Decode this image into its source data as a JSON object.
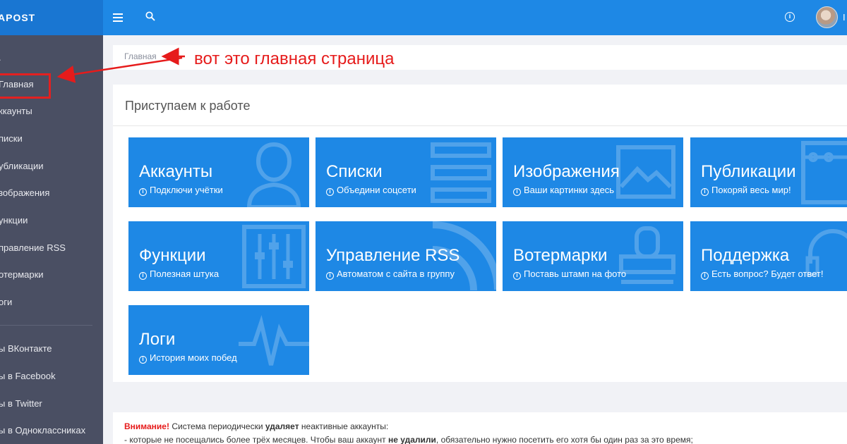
{
  "app": {
    "brand": "APOST",
    "user_initial": "I"
  },
  "topbar": {
    "menu_icon": "menu-icon",
    "search_icon": "search-icon",
    "info_icon": "info-icon"
  },
  "sidebar": {
    "items": [
      {
        "label": "Главная"
      },
      {
        "label": "ккаунты"
      },
      {
        "label": "писки"
      },
      {
        "label": "убликации"
      },
      {
        "label": "зображения"
      },
      {
        "label": "ункции"
      },
      {
        "label": "правление RSS"
      },
      {
        "label": "отермарки"
      },
      {
        "label": "оги"
      }
    ],
    "groups": [
      {
        "label": "ы ВКонтакте"
      },
      {
        "label": "ы в Facebook"
      },
      {
        "label": "ы в Twitter"
      },
      {
        "label": "ы в Одноклассниках"
      }
    ]
  },
  "breadcrumb": {
    "current": "Главная"
  },
  "annotation": {
    "text": "вот это главная страница",
    "color": "#e61b1b"
  },
  "panel": {
    "title": "Приступаем к работе"
  },
  "tiles": [
    {
      "title": "Аккаунты",
      "subtitle": "Подключи учётки",
      "icon": "user-icon"
    },
    {
      "title": "Списки",
      "subtitle": "Объедини соцсети",
      "icon": "list-icon"
    },
    {
      "title": "Изображения",
      "subtitle": "Ваши картинки здесь",
      "icon": "picture-icon"
    },
    {
      "title": "Публикации",
      "subtitle": "Покоряй весь мир!",
      "icon": "board-icon"
    },
    {
      "title": "Функции",
      "subtitle": "Полезная штука",
      "icon": "sliders-icon"
    },
    {
      "title": "Управление RSS",
      "subtitle": "Автоматом с сайта в группу",
      "icon": "rss-icon"
    },
    {
      "title": "Вотермарки",
      "subtitle": "Поставь штамп на фото",
      "icon": "stamp-icon"
    },
    {
      "title": "Поддержка",
      "subtitle": "Есть вопрос? Будет ответ!",
      "icon": "headset-icon"
    },
    {
      "title": "Логи",
      "subtitle": "История моих побед",
      "icon": "pulse-icon"
    }
  ],
  "notice": {
    "warning": "Внимание!",
    "line1_a": "Система периодически",
    "line1_b": "удаляет",
    "line1_c": "неактивные аккаунты:",
    "line2_a": "- которые не посещались более трёх месяцев. Чтобы ваш аккаунт",
    "line2_b": "не удалили",
    "line2_c": ", обязательно нужно посетить его хотя бы один раз за это время;"
  },
  "colors": {
    "topbar": "#1e88e5",
    "brand_bg": "#1976d2",
    "sidebar": "#4a4f63",
    "tile": "#1e88e5",
    "accent_red": "#e61b1b"
  }
}
